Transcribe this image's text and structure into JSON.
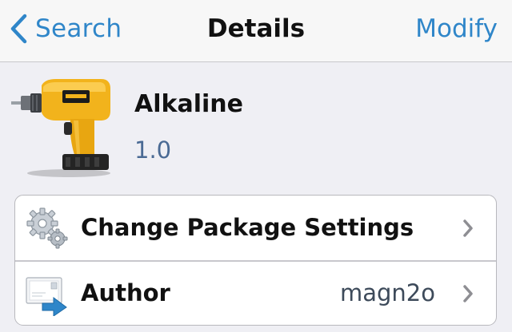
{
  "navbar": {
    "back_label": "Search",
    "title": "Details",
    "action_label": "Modify"
  },
  "package": {
    "name": "Alkaline",
    "version": "1.0",
    "icon": "power-drill-icon"
  },
  "rows": [
    {
      "label": "Change Package Settings",
      "value": "",
      "icon": "gears-icon"
    },
    {
      "label": "Author",
      "value": "magn2o",
      "icon": "mail-forward-icon"
    }
  ],
  "colors": {
    "accent": "#2f86c9",
    "background": "#efeff4",
    "version_text": "#4a6a94"
  }
}
